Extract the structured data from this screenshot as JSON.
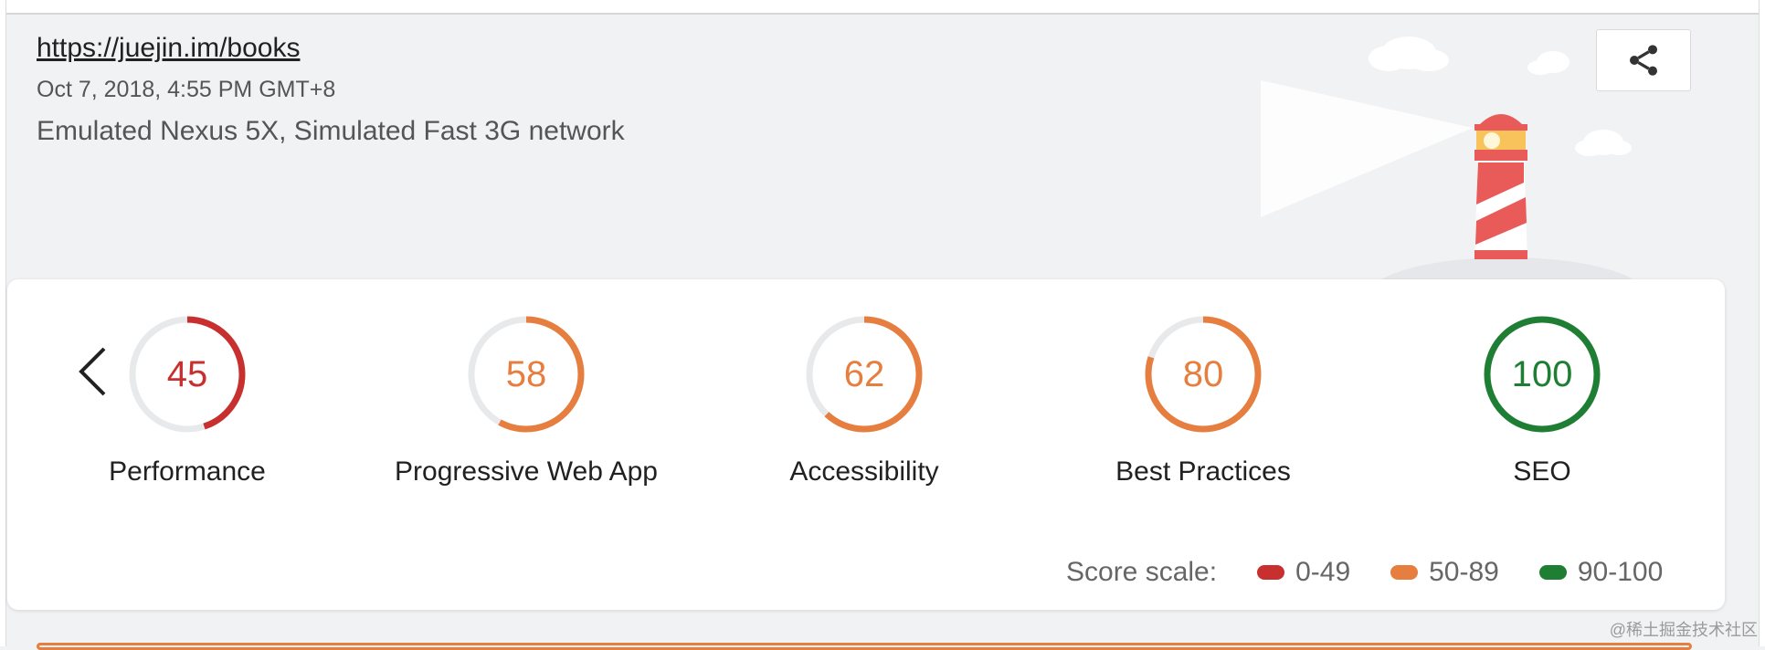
{
  "report": {
    "url": "https://juejin.im/books",
    "timestamp": "Oct 7, 2018, 4:55 PM GMT+8",
    "environment": "Emulated Nexus 5X, Simulated Fast 3G network"
  },
  "icons": {
    "share": "share-icon",
    "prev": "chevron-left-icon",
    "illustration": "lighthouse-icon"
  },
  "colors": {
    "fail": "#c7302f",
    "average": "#e67e3f",
    "pass": "#1e7e34",
    "track": "#e8e9eb"
  },
  "scores": [
    {
      "value": 45,
      "label": "Performance",
      "status": "fail"
    },
    {
      "value": 58,
      "label": "Progressive Web App",
      "status": "average"
    },
    {
      "value": 62,
      "label": "Accessibility",
      "status": "average"
    },
    {
      "value": 80,
      "label": "Best Practices",
      "status": "average"
    },
    {
      "value": 100,
      "label": "SEO",
      "status": "pass"
    }
  ],
  "scale": {
    "label": "Score scale:",
    "ranges": [
      {
        "text": "0-49",
        "status": "fail"
      },
      {
        "text": "50-89",
        "status": "average"
      },
      {
        "text": "90-100",
        "status": "pass"
      }
    ]
  },
  "watermark": "@稀土掘金技术社区"
}
